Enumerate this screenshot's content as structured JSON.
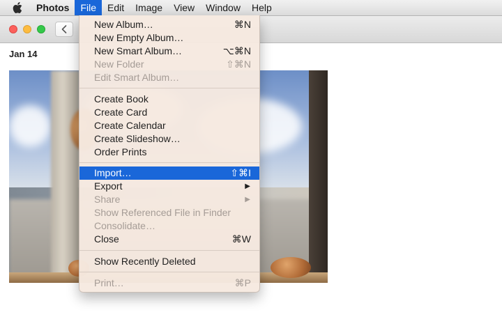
{
  "menubar": {
    "app_name": "Photos",
    "items": [
      "File",
      "Edit",
      "Image",
      "View",
      "Window",
      "Help"
    ]
  },
  "window": {
    "date_label": "Jan 14"
  },
  "file_menu": {
    "items": [
      {
        "label": "New Album…",
        "shortcut": "⌘N",
        "enabled": true
      },
      {
        "label": "New Empty Album…",
        "shortcut": "",
        "enabled": true
      },
      {
        "label": "New Smart Album…",
        "shortcut": "⌥⌘N",
        "enabled": true
      },
      {
        "label": "New Folder",
        "shortcut": "⇧⌘N",
        "enabled": false
      },
      {
        "label": "Edit Smart Album…",
        "shortcut": "",
        "enabled": false
      },
      {
        "label": "Create Book",
        "shortcut": "",
        "enabled": true
      },
      {
        "label": "Create Card",
        "shortcut": "",
        "enabled": true
      },
      {
        "label": "Create Calendar",
        "shortcut": "",
        "enabled": true
      },
      {
        "label": "Create Slideshow…",
        "shortcut": "",
        "enabled": true
      },
      {
        "label": "Order Prints",
        "shortcut": "",
        "enabled": true
      },
      {
        "label": "Import…",
        "shortcut": "⇧⌘I",
        "enabled": true,
        "highlighted": true
      },
      {
        "label": "Export",
        "shortcut": "",
        "enabled": true,
        "submenu": true
      },
      {
        "label": "Share",
        "shortcut": "",
        "enabled": false,
        "submenu": true
      },
      {
        "label": "Show Referenced File in Finder",
        "shortcut": "",
        "enabled": false
      },
      {
        "label": "Consolidate…",
        "shortcut": "",
        "enabled": false
      },
      {
        "label": "Close",
        "shortcut": "⌘W",
        "enabled": true
      },
      {
        "label": "Show Recently Deleted",
        "shortcut": "",
        "enabled": true
      },
      {
        "label": "Print…",
        "shortcut": "⌘P",
        "enabled": false
      }
    ]
  },
  "icons": {
    "apple": "apple-logo-icon",
    "back": "chevron-left-icon",
    "submenu": "triangle-right-icon"
  },
  "colors": {
    "highlight": "#1a67d9",
    "menu_background": "#f6e9e0",
    "disabled_text": "#a59c96"
  }
}
